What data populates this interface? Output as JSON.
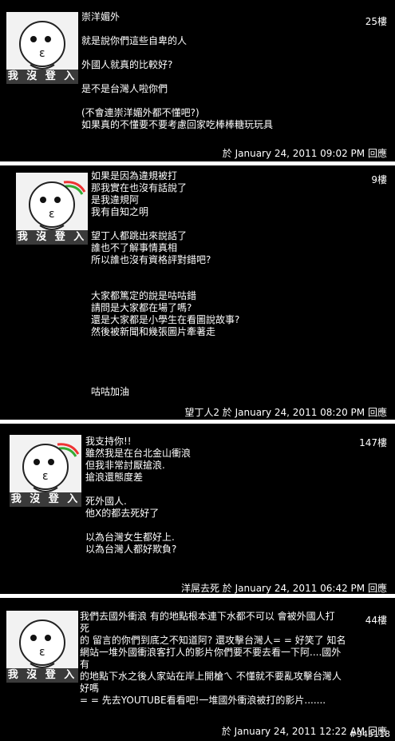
{
  "avatar_label": "我 沒 登 入",
  "reply_label": "回應",
  "posts": [
    {
      "floor": "25樓",
      "author": "",
      "date": "於 January 24, 2011 09:02 PM",
      "body": "崇洋媚外\n\n就是說你們這些自卑的人\n\n外國人就真的比較好?\n\n是不是台灣人啦你們\n\n(不會連崇洋媚外都不懂吧?)\n如果真的不懂要不要考慮回家吃棒棒糖玩玩具"
    },
    {
      "floor": "9樓",
      "author": "望丁人2",
      "date": "於 January 24, 2011 08:20 PM",
      "body": "如果是因為違規被打\n那我實在也沒有話說了\n是我違規阿\n我有自知之明\n\n望丁人都跳出來說話了\n誰也不了解事情真相\n所以誰也沒有資格評對錯吧?\n\n\n大家都篤定的說是咕咕錯\n請問是大家都在場了嗎?\n還是大家都是小學生在看圖說故事?\n然後被新聞和幾張圖片牽著走\n\n\n\n\n咕咕加油"
    },
    {
      "floor": "147樓",
      "author": "洋屌去死",
      "date": "於 January 24, 2011 06:42 PM",
      "body": "我支持你!!\n雖然我是在台北金山衝浪\n但我非常討厭搶浪.\n搶浪還態度差\n\n死外國人.\n他X的都去死好了\n\n以為台灣女生都好上.\n以為台灣人都好欺負?"
    },
    {
      "floor": "44樓",
      "author": "",
      "date": "於 January 24, 2011 12:22 AM",
      "body": "我們去國外衝浪 有的地點根本連下水都不可以 會被外國人打\n死\n的 留言的你們到底之不知道阿? 還攻擊台灣人= = 好笑了 知名\n網站一堆外國衝浪客打人的影片你們要不要去看一下阿....國外\n有\n的地點下水之後人家站在岸上開槍ㄟ 不懂就不要亂攻擊台灣人\n好嗎\n= = 先去YOUTUBE看看吧!一堆國外衝浪被打的影片......."
    }
  ],
  "page_id": "#945118"
}
